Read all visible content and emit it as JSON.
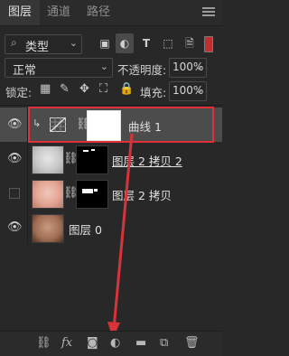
{
  "tabs": [
    "图层",
    "通道",
    "路径"
  ],
  "filter": {
    "label": "类型"
  },
  "blend_mode": "正常",
  "opacity": {
    "label": "不透明度:",
    "value": "100%"
  },
  "lock": {
    "label": "锁定:"
  },
  "fill": {
    "label": "填充:",
    "value": "100%"
  },
  "layers": [
    {
      "name": "曲线 1",
      "type": "curves-adjustment",
      "selected": true,
      "visible": true
    },
    {
      "name": "图层 2 拷贝 2",
      "visible": true
    },
    {
      "name": "图层 2 拷贝",
      "visible": false
    },
    {
      "name": "图层 0",
      "visible": true
    }
  ],
  "bottom_tools": [
    "link-icon",
    "fx-icon",
    "mask-icon",
    "adjustment-icon",
    "group-folder-icon",
    "new-layer-icon",
    "trash-icon"
  ],
  "colors": {
    "highlight": "#e0313b",
    "arrow": "#d8333a",
    "panel": "#282828"
  }
}
